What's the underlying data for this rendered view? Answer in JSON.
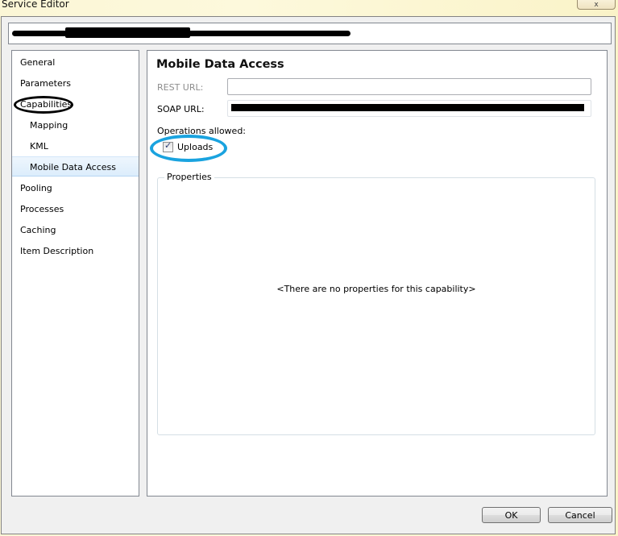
{
  "window": {
    "title": "Service Editor",
    "close_glyph": "x"
  },
  "connection": {
    "value": "[redacted]"
  },
  "nav": {
    "items": [
      {
        "label": "General",
        "level": 0,
        "selected": false
      },
      {
        "label": "Parameters",
        "level": 0,
        "selected": false
      },
      {
        "label": "Capabilities",
        "level": 0,
        "selected": false
      },
      {
        "label": "Mapping",
        "level": 1,
        "selected": false
      },
      {
        "label": "KML",
        "level": 1,
        "selected": false
      },
      {
        "label": "Mobile Data Access",
        "level": 1,
        "selected": true
      },
      {
        "label": "Pooling",
        "level": 0,
        "selected": false
      },
      {
        "label": "Processes",
        "level": 0,
        "selected": false
      },
      {
        "label": "Caching",
        "level": 0,
        "selected": false
      },
      {
        "label": "Item Description",
        "level": 0,
        "selected": false
      }
    ]
  },
  "panel": {
    "title": "Mobile Data Access",
    "rest_url_label": "REST URL:",
    "rest_url_value": "",
    "soap_url_label": "SOAP URL:",
    "soap_url_value": "[redacted]",
    "operations_label": "Operations allowed:",
    "uploads_label": "Uploads",
    "uploads_checked": true,
    "properties_label": "Properties",
    "properties_empty": "<There are no properties for this capability>"
  },
  "buttons": {
    "ok": "OK",
    "cancel": "Cancel"
  },
  "annotations": {
    "black_ellipse_color": "#000000",
    "blue_ellipse_color": "#1aa3df"
  }
}
